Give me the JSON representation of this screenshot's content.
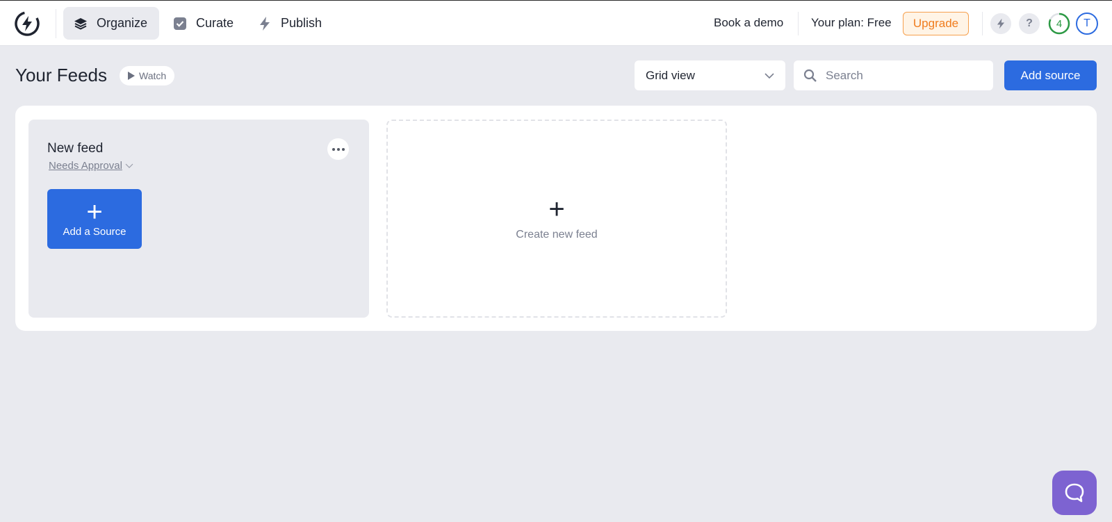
{
  "nav": {
    "items": [
      {
        "label": "Organize",
        "icon": "layers-icon",
        "active": true
      },
      {
        "label": "Curate",
        "icon": "checkbox-icon",
        "active": false
      },
      {
        "label": "Publish",
        "icon": "lightning-icon",
        "active": false
      }
    ],
    "book_demo": "Book a demo",
    "plan_text": "Your plan: Free",
    "upgrade": "Upgrade",
    "help": "?",
    "progress_count": "4",
    "avatar_initial": "T"
  },
  "header": {
    "title": "Your Feeds",
    "watch": "Watch",
    "view_select": "Grid view",
    "search_placeholder": "Search",
    "add_source": "Add source"
  },
  "feeds": [
    {
      "title": "New feed",
      "status": "Needs Approval",
      "add_source_label": "Add a Source"
    }
  ],
  "create_feed_label": "Create new feed",
  "colors": {
    "accent": "#2c6be0",
    "upgrade": "#f07c1e",
    "chat": "#7d63d1",
    "progress": "#2d9a45"
  }
}
